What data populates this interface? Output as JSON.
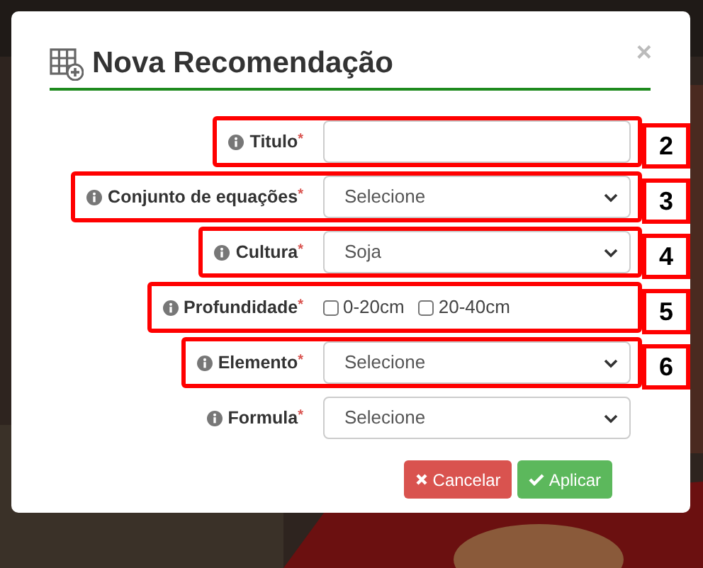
{
  "dialog": {
    "title": "Nova Recomendação",
    "close": "×",
    "fields": [
      {
        "kind": "text",
        "label": "Titulo",
        "required_mark": "*",
        "annotation": "2"
      },
      {
        "kind": "select",
        "label": "Conjunto de equações",
        "required_mark": "*",
        "value": "Selecione",
        "annotation": "3"
      },
      {
        "kind": "select",
        "label": "Cultura",
        "required_mark": "*",
        "value": "Soja",
        "annotation": "4"
      },
      {
        "kind": "checkboxes",
        "label": "Profundidade",
        "required_mark": "*",
        "options": [
          {
            "label": "0-20cm",
            "checked": false
          },
          {
            "label": "20-40cm",
            "checked": false
          }
        ],
        "annotation": "5"
      },
      {
        "kind": "select",
        "label": "Elemento",
        "required_mark": "*",
        "value": "Selecione",
        "annotation": "6"
      },
      {
        "kind": "select",
        "label": "Formula",
        "required_mark": "*",
        "value": "Selecione"
      }
    ],
    "buttons": [
      {
        "kind": "cancel",
        "label": "Cancelar"
      },
      {
        "kind": "apply",
        "label": "Aplicar"
      }
    ]
  }
}
